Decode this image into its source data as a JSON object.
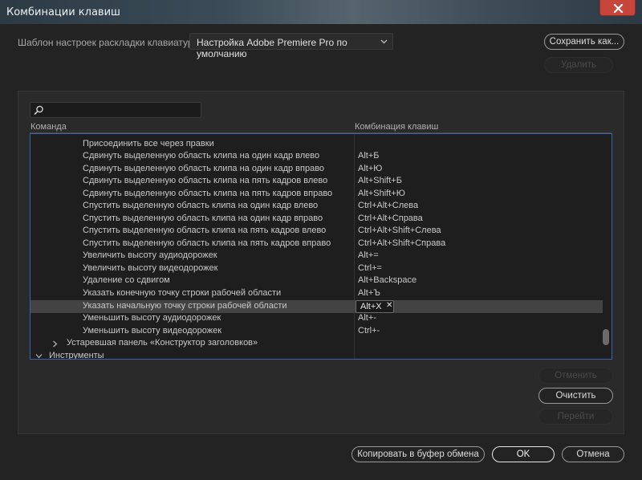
{
  "window": {
    "title": "Комбинации клавиш"
  },
  "preset": {
    "label": "Шаблон настроек раскладки клавиатуры:",
    "value": "Настройка Adobe Premiere Pro по умолчанию"
  },
  "buttons": {
    "save_as": "Сохранить как...",
    "delete": "Удалить",
    "cancel_shortcut": "Отменить",
    "clear": "Очистить",
    "goto": "Перейти",
    "copy_clipboard": "Копировать в буфер обмена",
    "ok": "OK",
    "cancel": "Отмена"
  },
  "search": {
    "value": ""
  },
  "columns": {
    "command": "Команда",
    "shortcut": "Комбинация клавиш"
  },
  "rows": [
    {
      "command": "Присоединить все через правки",
      "shortcut": ""
    },
    {
      "command": "Сдвинуть выделенную область клипа на один кадр влево",
      "shortcut": "Alt+Б"
    },
    {
      "command": "Сдвинуть выделенную область клипа на один кадр вправо",
      "shortcut": "Alt+Ю"
    },
    {
      "command": "Сдвинуть выделенную область клипа на пять кадров влево",
      "shortcut": "Alt+Shift+Б"
    },
    {
      "command": "Сдвинуть выделенную область клипа на пять кадров вправо",
      "shortcut": "Alt+Shift+Ю"
    },
    {
      "command": "Спустить выделенную область клипа на один кадр влево",
      "shortcut": "Ctrl+Alt+Слева"
    },
    {
      "command": "Спустить выделенную область клипа на один кадр вправо",
      "shortcut": "Ctrl+Alt+Справа"
    },
    {
      "command": "Спустить выделенную область клипа на пять кадров влево",
      "shortcut": "Ctrl+Alt+Shift+Слева"
    },
    {
      "command": "Спустить выделенную область клипа на пять кадров вправо",
      "shortcut": "Ctrl+Alt+Shift+Справа"
    },
    {
      "command": "Увеличить высоту аудиодорожек",
      "shortcut": "Alt+="
    },
    {
      "command": "Увеличить высоту видеодорожек",
      "shortcut": "Ctrl+="
    },
    {
      "command": "Удаление со сдвигом",
      "shortcut": "Alt+Backspace"
    },
    {
      "command": "Указать конечную точку строки рабочей области",
      "shortcut": "Alt+Ъ"
    },
    {
      "command": "Указать начальную точку строки рабочей области",
      "shortcut": "Alt+X"
    },
    {
      "command": "Уменьшить высоту аудиодорожек",
      "shortcut": "Alt+-"
    },
    {
      "command": "Уменьшить высоту видеодорожек",
      "shortcut": "Ctrl+-"
    }
  ],
  "selected_row_index": 13,
  "groups": {
    "legacy_titler": "Устаревшая панель «Конструктор заголовков»",
    "tools": "Инструменты"
  },
  "colors": {
    "list_focus_border": "#3f63a8",
    "close_button": "#c7453b",
    "selected_row": "#434343"
  },
  "icons": {
    "search": "search-icon",
    "close": "close-icon",
    "dropdown": "chevron-down-icon",
    "collapsed": "chevron-right-icon",
    "expanded": "chevron-down-icon",
    "remove_shortcut": "remove-shortcut-icon"
  }
}
